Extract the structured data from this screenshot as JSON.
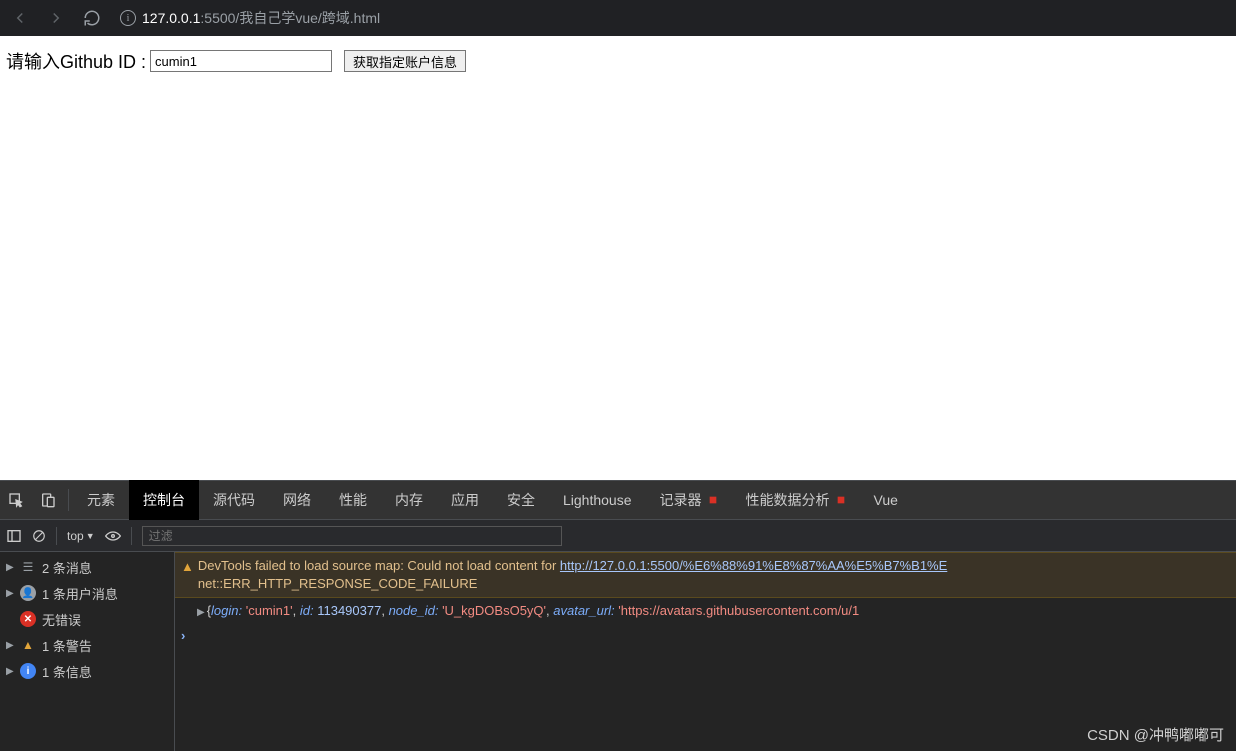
{
  "browser": {
    "url_host": "127.0.0.1",
    "url_rest": ":5500/我自己学vue/跨域.html"
  },
  "page": {
    "label": "请输入Github ID :",
    "input_value": "cumin1",
    "button": "获取指定账户信息"
  },
  "devtools": {
    "tabs": {
      "elements": "元素",
      "console": "控制台",
      "sources": "源代码",
      "network": "网络",
      "performance": "性能",
      "memory": "内存",
      "application": "应用",
      "security": "安全",
      "lighthouse": "Lighthouse",
      "recorder": "记录器",
      "perf_insights": "性能数据分析",
      "vue": "Vue"
    },
    "filterbar": {
      "context": "top",
      "filter_placeholder": "过滤"
    },
    "sidebar": {
      "messages": "2 条消息",
      "user_messages": "1 条用户消息",
      "no_errors": "无错误",
      "warnings": "1 条警告",
      "info": "1 条信息"
    },
    "console": {
      "warn_prefix": "DevTools failed to load source map: Could not load content for ",
      "warn_link": "http://127.0.0.1:5500/%E6%88%91%E8%87%AA%E5%B7%B1%E",
      "warn_suffix": "net::ERR_HTTP_RESPONSE_CODE_FAILURE",
      "obj": {
        "login_key": "login:",
        "login_val": "'cumin1'",
        "id_key": "id:",
        "id_val": "113490377",
        "node_id_key": "node_id:",
        "node_id_val": "'U_kgDOBsO5yQ'",
        "avatar_key": "avatar_url:",
        "avatar_val": "'https://avatars.githubusercontent.com/u/1"
      }
    }
  },
  "watermark": "CSDN @冲鸭嘟嘟可"
}
